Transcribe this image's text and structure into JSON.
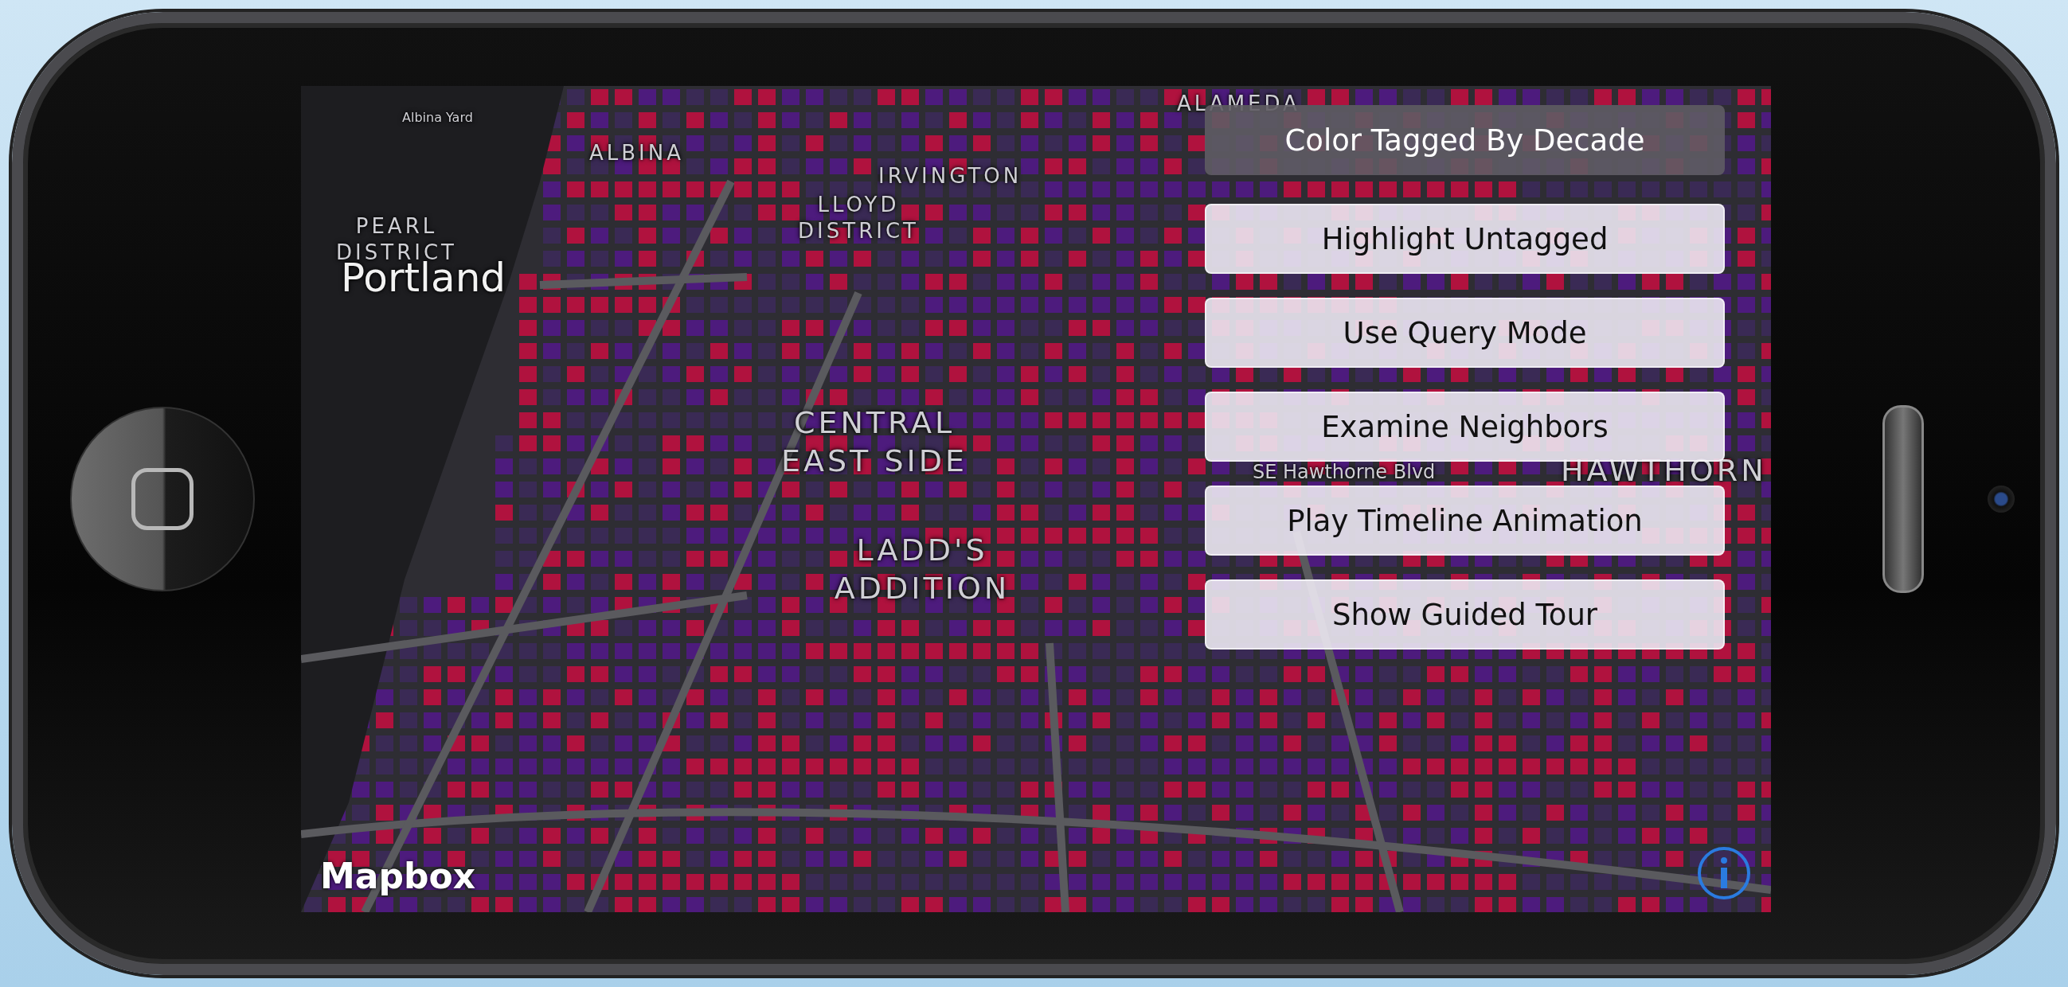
{
  "map": {
    "labels": [
      {
        "text": "Albina Yard",
        "kind": "small"
      },
      {
        "text": "ALAMEDA",
        "kind": "district"
      },
      {
        "text": "ALBINA",
        "kind": "district"
      },
      {
        "text": "IRVINGTON",
        "kind": "district"
      },
      {
        "text": "LLOYD DISTRICT",
        "kind": "district"
      },
      {
        "text": "PEARL DISTRICT",
        "kind": "district"
      },
      {
        "text": "Portland",
        "kind": "city"
      },
      {
        "text": "CENTRAL EAST SIDE",
        "kind": "neighborhood"
      },
      {
        "text": "LADD'S ADDITION",
        "kind": "neighborhood"
      },
      {
        "text": "SE Hawthorne Blvd",
        "kind": "street"
      },
      {
        "text": "HAWTHORN",
        "kind": "neighborhood"
      }
    ]
  },
  "buttons": [
    {
      "label": "Color Tagged By Decade",
      "selected": true
    },
    {
      "label": "Highlight Untagged",
      "selected": false
    },
    {
      "label": "Use Query Mode",
      "selected": false
    },
    {
      "label": "Examine Neighbors",
      "selected": false
    },
    {
      "label": "Play Timeline Animation",
      "selected": false
    },
    {
      "label": "Show Guided Tour",
      "selected": false
    }
  ],
  "attribution": {
    "logo": "Mapbox"
  }
}
